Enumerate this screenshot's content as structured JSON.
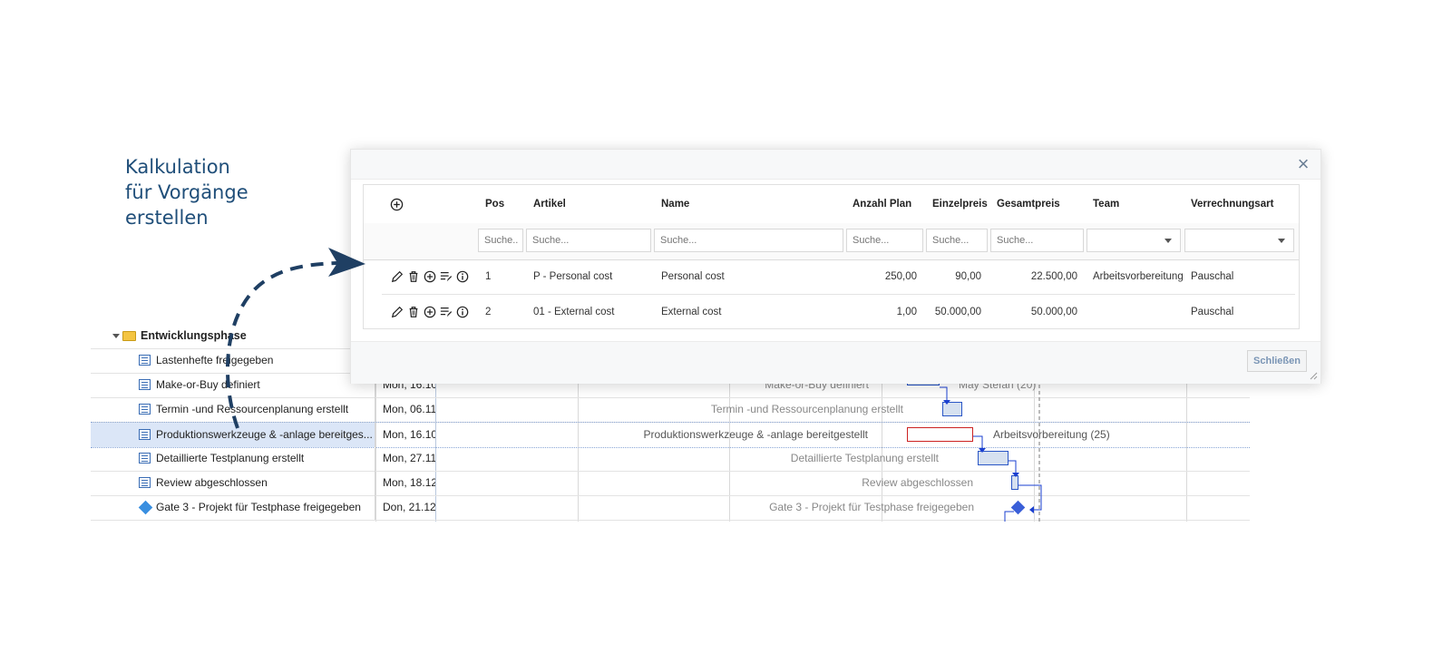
{
  "caption": {
    "line1": "Kalkulation",
    "line2": "für Vorgänge",
    "line3": "erstellen"
  },
  "dialog": {
    "columns": [
      "Pos",
      "Artikel",
      "Name",
      "Anzahl Plan",
      "Einzelpreis",
      "Gesamtpreis",
      "Team",
      "Verrechnungsart"
    ],
    "filter_placeholder_short": "Suche..",
    "filter_placeholder": "Suche...",
    "rows": [
      {
        "pos": "1",
        "artikel": "P - Personal cost",
        "name": "Personal cost",
        "anzahl": "250,00",
        "einzelpreis": "90,00",
        "gesamtpreis": "22.500,00",
        "team": "Arbeitsvorbereitung",
        "verrechnungsart": "Pauschal"
      },
      {
        "pos": "2",
        "artikel": "01 - External cost",
        "name": "External cost",
        "anzahl": "1,00",
        "einzelpreis": "50.000,00",
        "gesamtpreis": "50.000,00",
        "team": "",
        "verrechnungsart": "Pauschal"
      }
    ],
    "close_label": "Schließen",
    "close_icon": "×"
  },
  "gantt": {
    "phase": "Entwicklungsphase",
    "tasks": [
      {
        "name": "Lastenhefte freigegeben",
        "date": "",
        "bar_label": "",
        "resource": ""
      },
      {
        "name": "Make-or-Buy definiert",
        "date": "Mon, 16.10",
        "bar_label": "Make-or-Buy definiert",
        "resource": "May Stefan (20)"
      },
      {
        "name": "Termin -und Ressourcenplanung erstellt",
        "date": "Mon, 06.11",
        "bar_label": "Termin -und Ressourcenplanung erstellt",
        "resource": ""
      },
      {
        "name": "Produktionswerkzeuge & -anlage bereitges...",
        "date": "Mon, 16.10",
        "bar_label": "Produktionswerkzeuge & -anlage bereitgestellt",
        "resource": "Arbeitsvorbereitung (25)"
      },
      {
        "name": "Detaillierte Testplanung erstellt",
        "date": "Mon, 27.11",
        "bar_label": "Detaillierte Testplanung erstellt",
        "resource": ""
      },
      {
        "name": "Review abgeschlossen",
        "date": "Mon, 18.12",
        "bar_label": "Review abgeschlossen",
        "resource": ""
      },
      {
        "name": "Gate 3 - Projekt für Testphase freigegeben",
        "date": "Don, 21.12",
        "bar_label": "Gate 3 - Projekt für Testphase freigegeben",
        "resource": ""
      }
    ]
  },
  "colors": {
    "accent": "#1f4e79",
    "bar_border": "#2a56c6",
    "bar_fill": "#d6e1f0",
    "critical": "#cc2222",
    "milestone": "#3a8fe0"
  }
}
